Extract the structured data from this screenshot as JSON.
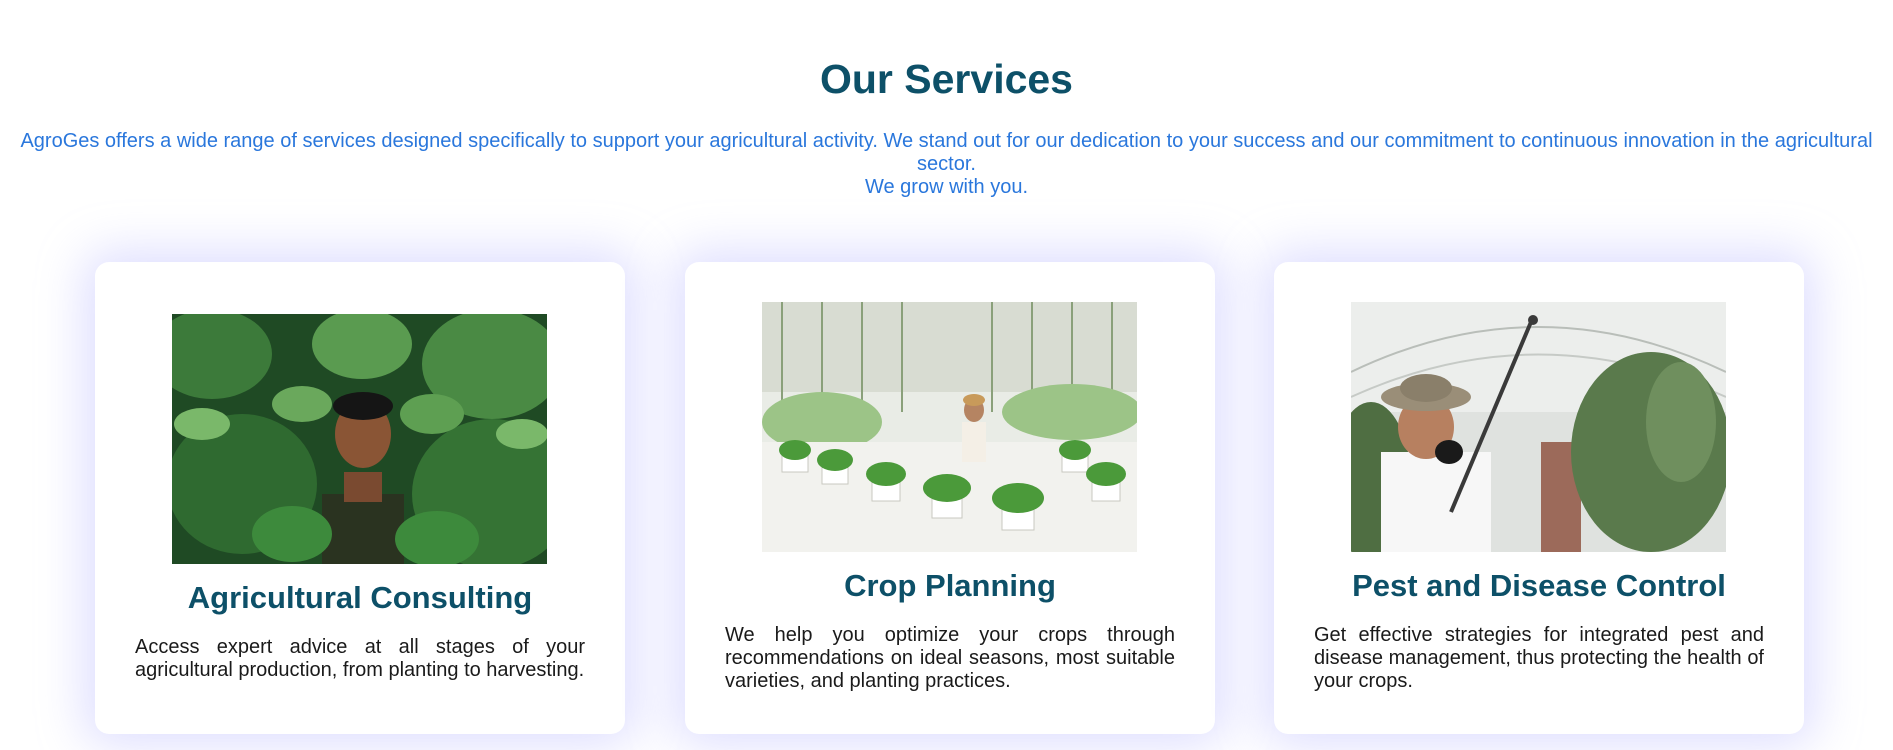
{
  "services": {
    "title": "Our Services",
    "intro_line1": "AgroGes offers a wide range of services designed specifically to support your agricultural activity. We stand out for our dedication to your success and our commitment to continuous innovation in the agricultural sector.",
    "intro_line2": "We grow with you.",
    "cards": [
      {
        "title": "Agricultural Consulting",
        "text": "Access expert advice at all stages of your agricultural production, from planting to harvesting.",
        "image": "farmer-in-green-crop-photo"
      },
      {
        "title": "Crop Planning",
        "text": "We help you optimize your crops through recommendations on ideal seasons, most suitable varieties, and planting practices.",
        "image": "woman-in-greenhouse-photo"
      },
      {
        "title": "Pest and Disease Control",
        "text": "Get effective strategies for integrated pest and disease management, thus protecting the health of your crops.",
        "image": "man-spraying-plants-photo"
      }
    ]
  },
  "colors": {
    "heading": "#0d5068",
    "intro_text": "#2a77dc",
    "card_shadow": "#d2d2ff",
    "body_text": "#1a1a1a"
  }
}
